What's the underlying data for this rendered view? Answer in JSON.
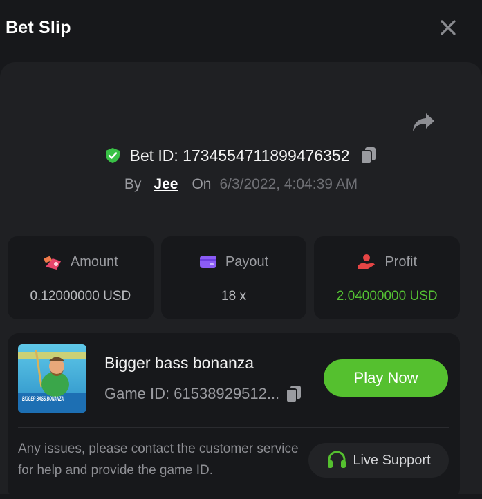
{
  "header": {
    "title": "Bet Slip",
    "close_icon": "close-icon"
  },
  "bet": {
    "id_label": "Bet ID: 1734554711899476352",
    "by_label": "By",
    "user": "Jee",
    "on_label": "On",
    "date": "6/3/2022, 4:04:39 AM",
    "verified_icon": "shield-check-icon",
    "share_icon": "share-icon",
    "copy_icon": "copy-icon"
  },
  "stats": {
    "amount": {
      "label": "Amount",
      "value": "0.12000000 USD",
      "icon": "money-bag-icon",
      "color": "#e8456b"
    },
    "payout": {
      "label": "Payout",
      "value": "18 x",
      "icon": "card-icon",
      "color": "#8b5cf6"
    },
    "profit": {
      "label": "Profit",
      "value": "2.04000000 USD",
      "icon": "hand-coin-icon",
      "color": "#e64545"
    }
  },
  "game": {
    "name": "Bigger bass bonanza",
    "id_label": "Game ID: 61538929512...",
    "thumb_text": "BIGGER BASS BONANZA",
    "play_label": "Play Now",
    "help_text": "Any issues, please contact the customer service for help and provide the game ID.",
    "support_label": "Live Support",
    "support_icon": "headset-icon"
  },
  "colors": {
    "background": "#17181b",
    "panel": "#1f2023",
    "accent_green": "#55c02f",
    "profit_green": "#54c133"
  }
}
